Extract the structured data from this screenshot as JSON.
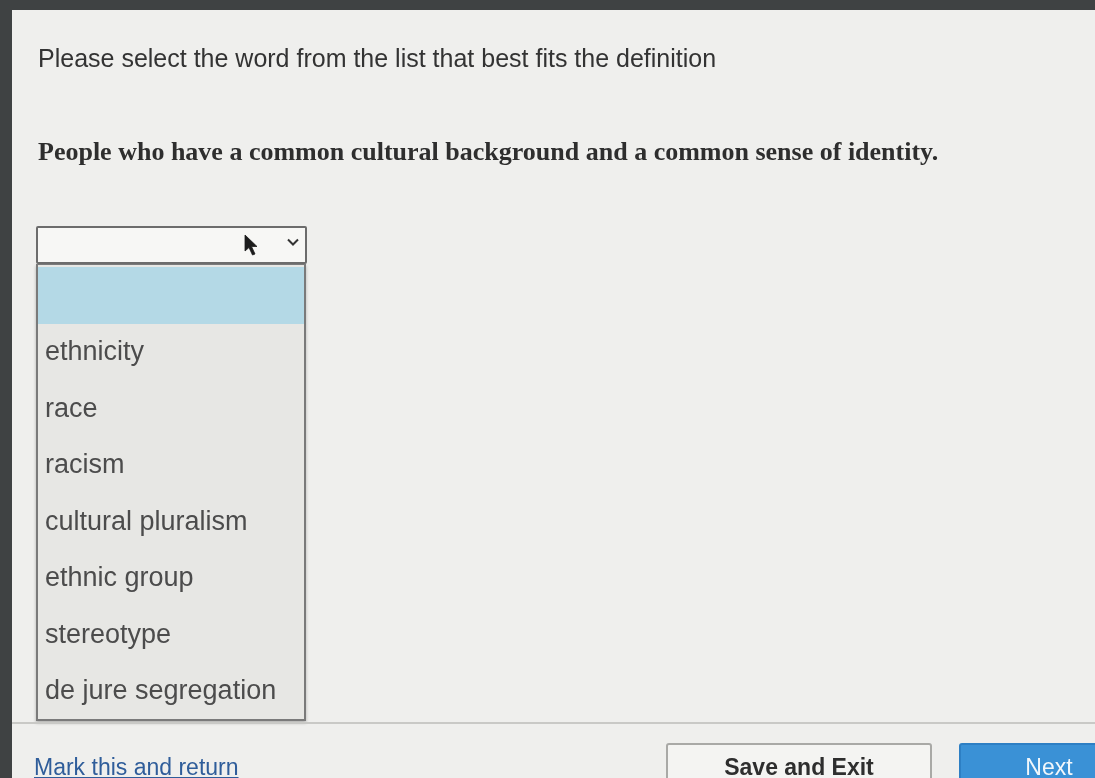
{
  "instruction": "Please select the word from the list that best fits the definition",
  "definition": "People who have a common cultural background and a common sense of identity.",
  "dropdown": {
    "expanded": true,
    "options": [
      {
        "selected": true
      },
      {
        "label": "ethnicity",
        "selected": false
      },
      {
        "label": "race",
        "selected": false
      },
      {
        "label": "racism",
        "selected": false
      },
      {
        "label": "cultural pluralism",
        "selected": false
      },
      {
        "label": "ethnic group",
        "selected": false
      },
      {
        "label": "stereotype",
        "selected": false
      },
      {
        "label": "de jure segregation",
        "selected": false
      }
    ]
  },
  "actions": [
    {
      "kind": "link",
      "label": "Mark this and return"
    },
    {
      "kind": "secondary",
      "label": "Save and Exit"
    },
    {
      "kind": "primary",
      "label": "Next"
    }
  ]
}
